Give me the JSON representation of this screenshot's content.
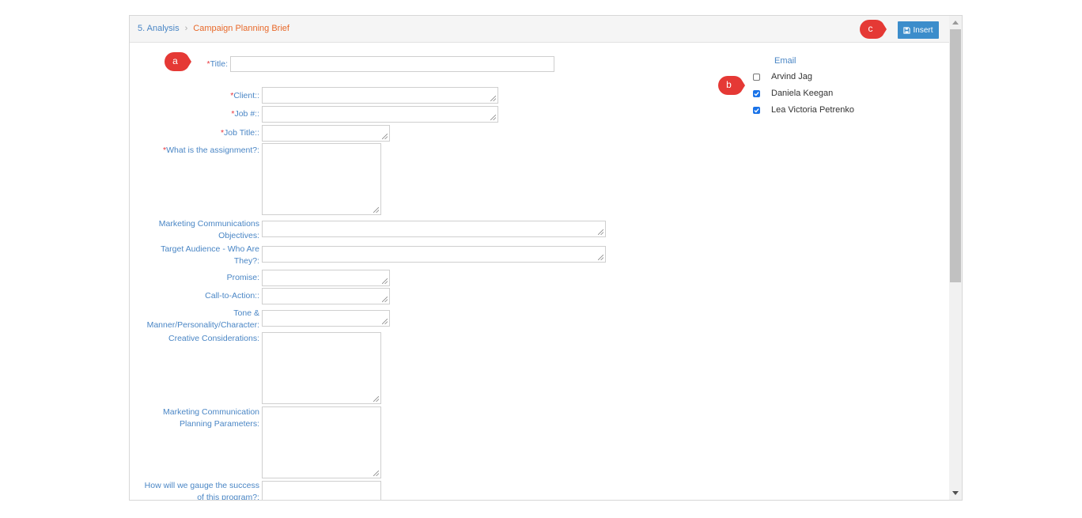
{
  "breadcrumb": {
    "parent": "5. Analysis",
    "separator": ">",
    "current": "Campaign Planning Brief"
  },
  "toolbar": {
    "insert_label": "Insert"
  },
  "form": {
    "title_label": "Title:",
    "client_label": "Client::",
    "job_number_label": "Job #::",
    "job_title_label": "Job Title::",
    "assignment_label": "What is the assignment?:",
    "mc_objectives_label": "Marketing Communications Objectives:",
    "target_audience_label": "Target Audience - Who Are They?:",
    "promise_label": "Promise:",
    "cta_label": "Call-to-Action::",
    "tone_label": "Tone & Manner/Personality/Character:",
    "creative_label": "Creative Considerations:",
    "mc_planning_label": "Marketing Communication Planning Parameters:",
    "gauge_label": "How will we gauge the success of this program?:",
    "required_marker": "*"
  },
  "email": {
    "title": "Email",
    "recipients": [
      {
        "name": "Arvind Jag",
        "checked": false
      },
      {
        "name": "Daniela Keegan",
        "checked": true
      },
      {
        "name": "Lea Victoria Petrenko",
        "checked": true
      }
    ]
  },
  "annotations": {
    "a": "a",
    "b": "b",
    "c": "c",
    "color": "#e53935"
  },
  "colors": {
    "accent": "#3c8dcb",
    "label": "#4a86c5",
    "required": "#e8343b",
    "current_crumb": "#e8692a"
  }
}
